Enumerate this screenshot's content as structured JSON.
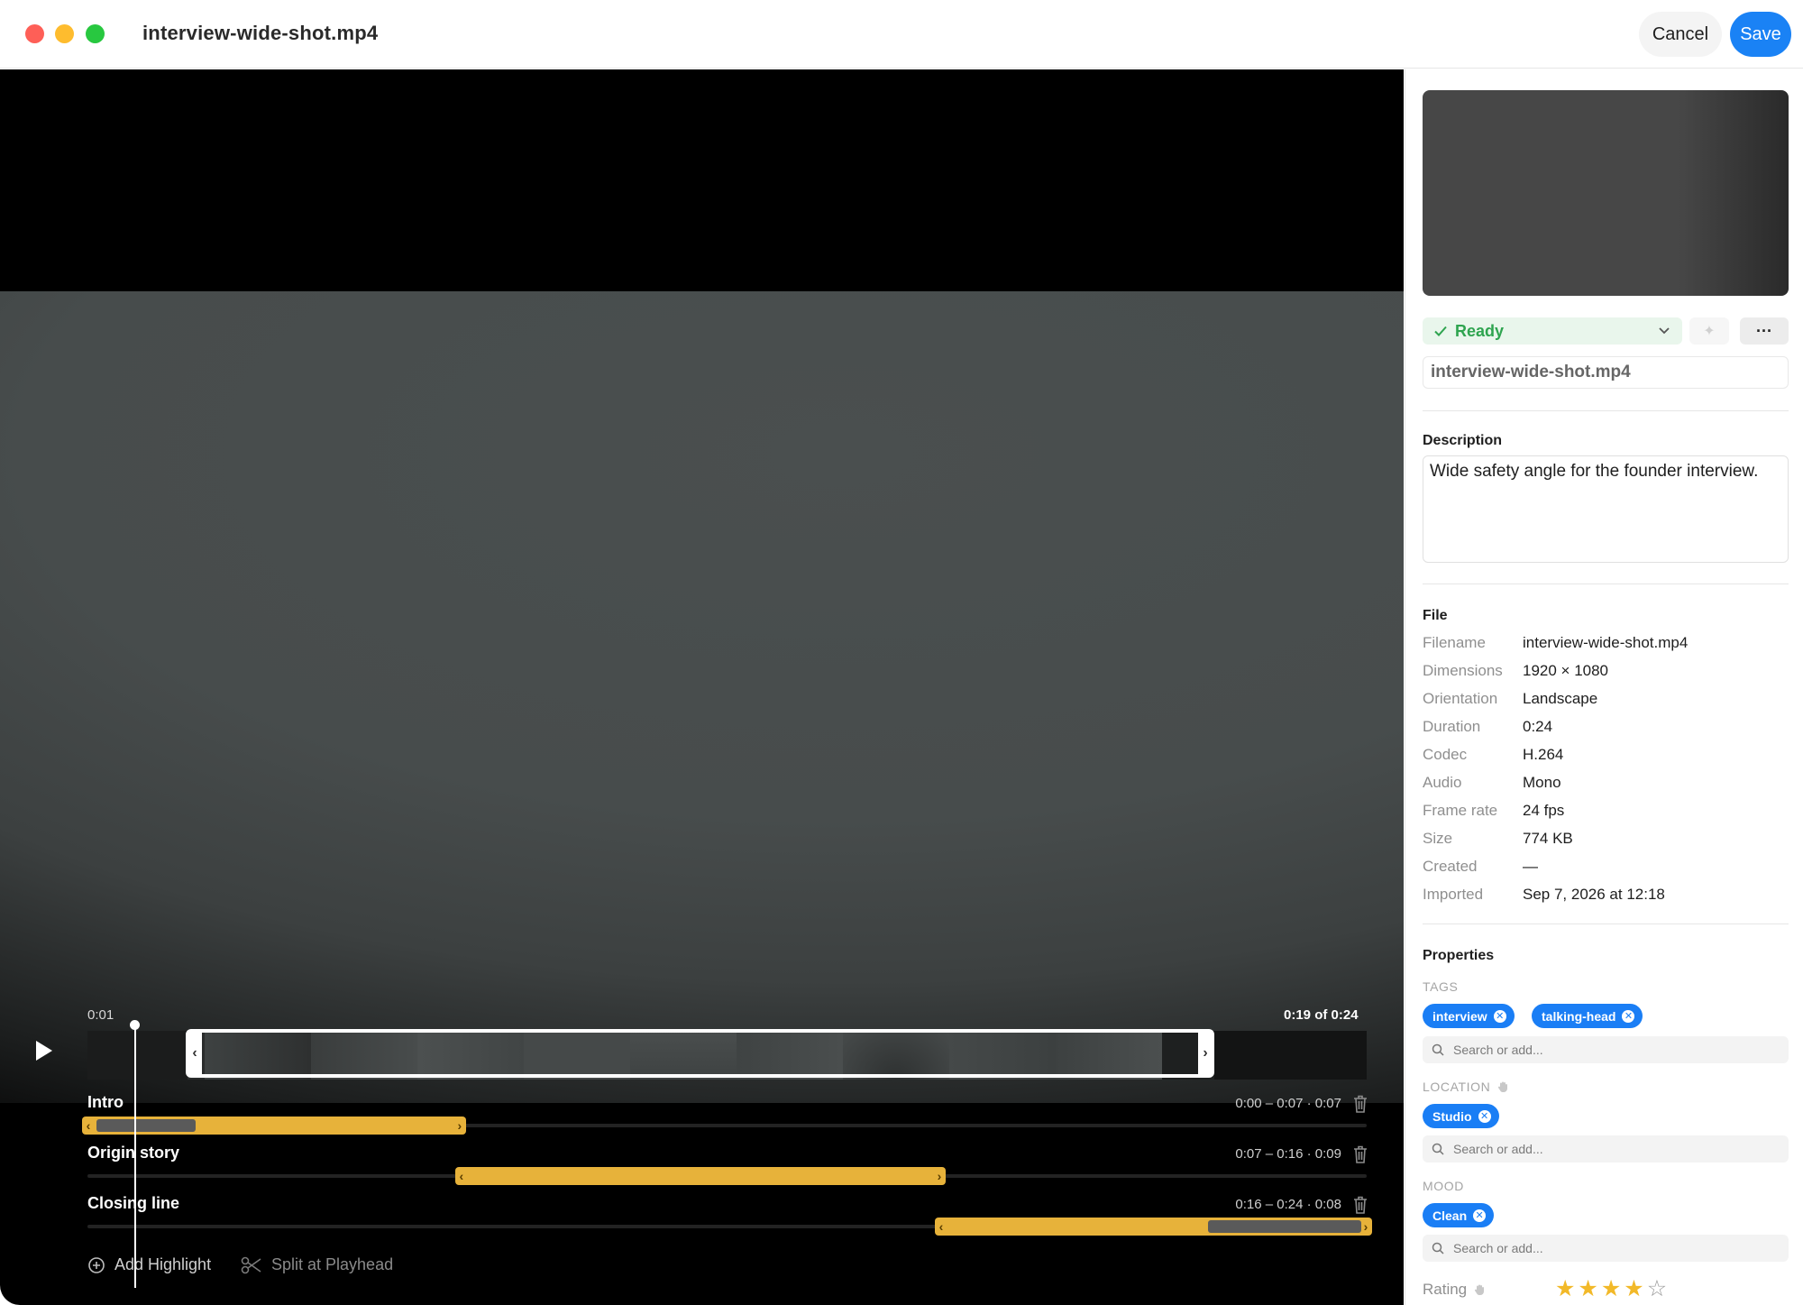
{
  "window": {
    "title": "interview-wide-shot.mp4",
    "cancel_label": "Cancel",
    "save_label": "Save",
    "traffic_lights": [
      "#fe5f57",
      "#febc2e",
      "#28c840"
    ]
  },
  "player": {
    "playhead_time": "0:01",
    "position_label": "0:19 of 0:24",
    "play_icon": "play-icon"
  },
  "highlights": [
    {
      "name": "Intro",
      "range": "0:00 – 0:07 · 0:07",
      "start": 0,
      "end": 7
    },
    {
      "name": "Origin story",
      "range": "0:07 – 0:16 · 0:09",
      "start": 7,
      "end": 16
    },
    {
      "name": "Closing line",
      "range": "0:16 – 0:24 · 0:08",
      "start": 16,
      "end": 24
    }
  ],
  "actions": {
    "add_highlight": "Add Highlight",
    "split": "Split at Playhead"
  },
  "sidebar": {
    "status": "Ready",
    "filename_field": "interview-wide-shot.mp4",
    "description_title": "Description",
    "description": "Wide safety angle for the founder interview.",
    "file_title": "File",
    "file": [
      {
        "key": "Filename",
        "value": "interview-wide-shot.mp4"
      },
      {
        "key": "Dimensions",
        "value": "1920 × 1080"
      },
      {
        "key": "Orientation",
        "value": "Landscape"
      },
      {
        "key": "Duration",
        "value": "0:24"
      },
      {
        "key": "Codec",
        "value": "H.264"
      },
      {
        "key": "Audio",
        "value": "Mono"
      },
      {
        "key": "Frame rate",
        "value": "24 fps"
      },
      {
        "key": "Size",
        "value": "774 KB"
      },
      {
        "key": "Created",
        "value": "—"
      },
      {
        "key": "Imported",
        "value": "Sep 7, 2026 at 12:18"
      }
    ],
    "properties_title": "Properties",
    "tags_label": "TAGS",
    "tags": [
      "interview",
      "talking-head"
    ],
    "location_label": "LOCATION",
    "location": [
      "Studio"
    ],
    "mood_label": "MOOD",
    "mood": [
      "Clean"
    ],
    "search_placeholder": "Search or add...",
    "rating_label": "Rating",
    "rating": 4,
    "rating_max": 5,
    "accent_color": "#1a7ef5",
    "status_color": "#2ea44f",
    "highlight_color": "#e7b23a"
  }
}
